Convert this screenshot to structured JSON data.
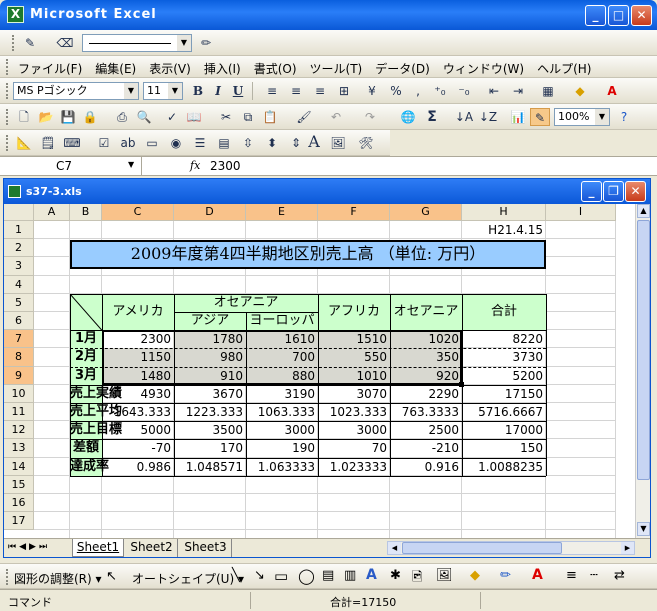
{
  "window": {
    "title": "Microsoft Excel",
    "icon": "excel-icon"
  },
  "menu": [
    "ファイル(F)",
    "編集(E)",
    "表示(V)",
    "挿入(I)",
    "書式(O)",
    "ツール(T)",
    "データ(D)",
    "ウィンドウ(W)",
    "ヘルプ(H)"
  ],
  "format_toolbar": {
    "font": "MS Pゴシック",
    "size": "11",
    "percent": "%",
    "comma": ","
  },
  "standard_toolbar": {
    "zoom": "100%",
    "sigma": "Σ"
  },
  "formula_bar": {
    "name_box": "C7",
    "fx": "fx",
    "value": "2300"
  },
  "workbook": {
    "title": "s37-3.xls"
  },
  "columns": [
    "A",
    "B",
    "C",
    "D",
    "E",
    "F",
    "G",
    "H",
    "I"
  ],
  "rows": [
    "1",
    "2",
    "3",
    "4",
    "5",
    "6",
    "7",
    "8",
    "9",
    "10",
    "11",
    "12",
    "13",
    "14",
    "15",
    "16",
    "17"
  ],
  "sheet": {
    "date": "H21.4.15",
    "title": "2009年度第4四半期地区別売上高 （単位: 万円）",
    "headers": {
      "america": "アメリカ",
      "oceania_group": "オセアニア",
      "asia": "アジア",
      "europe": "ヨーロッパ",
      "africa": "アフリカ",
      "oceania": "オセアニア",
      "total": "合計"
    },
    "data_rows": [
      {
        "label": "1月",
        "values": [
          "2300",
          "1780",
          "1610",
          "1510",
          "1020",
          "8220"
        ]
      },
      {
        "label": "2月",
        "values": [
          "1150",
          "980",
          "700",
          "550",
          "350",
          "3730"
        ]
      },
      {
        "label": "3月",
        "values": [
          "1480",
          "910",
          "880",
          "1010",
          "920",
          "5200"
        ]
      },
      {
        "label": "売上実績",
        "values": [
          "4930",
          "3670",
          "3190",
          "3070",
          "2290",
          "17150"
        ]
      },
      {
        "label": "売上平均",
        "values": [
          "1643.333",
          "1223.333",
          "1063.333",
          "1023.333",
          "763.3333",
          "5716.6667"
        ]
      },
      {
        "label": "売上目標",
        "values": [
          "5000",
          "3500",
          "3000",
          "3000",
          "2500",
          "17000"
        ]
      },
      {
        "label": "差額",
        "values": [
          "-70",
          "170",
          "190",
          "70",
          "-210",
          "150"
        ]
      },
      {
        "label": "達成率",
        "values": [
          "0.986",
          "1.048571",
          "1.063333",
          "1.023333",
          "0.916",
          "1.0088235"
        ]
      }
    ]
  },
  "tabs": [
    "Sheet1",
    "Sheet2",
    "Sheet3"
  ],
  "drawing_toolbar": {
    "adjust": "図形の調整(R) ▾",
    "autoshape": "オートシェイプ(U) ▾"
  },
  "status": {
    "mode": "コマンド",
    "sum": "合計=17150"
  },
  "colors": {
    "title_fill": "#99ccff",
    "header_fill": "#ccffcc",
    "selection_fill": "#d8d8d0",
    "selected_header": "#f9c28a"
  }
}
